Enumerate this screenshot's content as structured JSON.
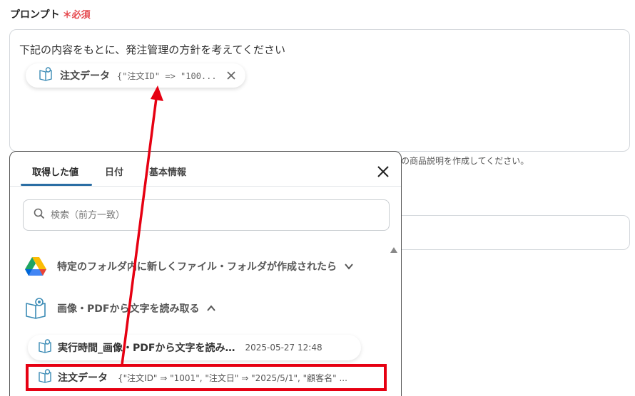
{
  "field": {
    "label": "プロンプト",
    "required_mark": "＊必須"
  },
  "prompt": {
    "text": "下記の内容をもとに、発注管理の方針を考えてください",
    "chip": {
      "icon": "book-icon",
      "label": "注文データ",
      "value": "{\"注文ID\" => \"100...",
      "close_icon": "close-icon"
    }
  },
  "hint": {
    "text": "の商品説明を作成してください。"
  },
  "popup": {
    "tabs": [
      {
        "label": "取得した値",
        "active": true
      },
      {
        "label": "日付",
        "active": false
      },
      {
        "label": "基本情報",
        "active": false
      }
    ],
    "search_placeholder": "検索（前方一致）",
    "groups": [
      {
        "icon": "google-drive-icon",
        "label": "特定のフォルダ内に新しくファイル・フォルダが作成されたら",
        "expanded": false
      },
      {
        "icon": "ocr-book-icon",
        "label": "画像・PDFから文字を読み取る",
        "expanded": true
      }
    ],
    "items": [
      {
        "icon": "book-icon",
        "label": "実行時間_画像・PDFから文字を読み…",
        "value": "2025-05-27 12:48"
      },
      {
        "icon": "book-icon",
        "label": "注文データ",
        "value": "{\"注文ID\" ⇒ \"1001\", \"注文日\" ⇒ \"2025/5/1\", \"顧客名\" ..."
      }
    ]
  },
  "colors": {
    "accent": "#2b6ea4",
    "required": "#e5484d",
    "annotation": "#e60012"
  }
}
